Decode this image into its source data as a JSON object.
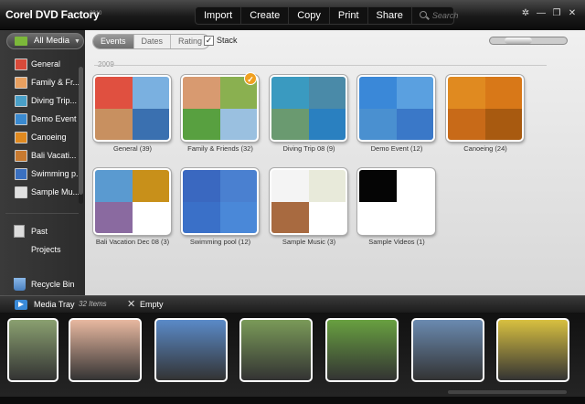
{
  "app": {
    "title": "Corel DVD Factory",
    "version": "2010"
  },
  "menu": [
    {
      "label": "Import"
    },
    {
      "label": "Create"
    },
    {
      "label": "Copy"
    },
    {
      "label": "Print"
    },
    {
      "label": "Share"
    }
  ],
  "search": {
    "placeholder": "Search"
  },
  "window_controls": {
    "settings": "✲",
    "minimize": "—",
    "restore": "❐",
    "close": "✕"
  },
  "sidebar": {
    "filter_label": "All Media",
    "items": [
      {
        "label": "General",
        "color": "#d84a3a"
      },
      {
        "label": "Family & Fr...",
        "color": "#e8a060"
      },
      {
        "label": "Diving Trip...",
        "color": "#4aa0c8"
      },
      {
        "label": "Demo Event",
        "color": "#3a8ad0"
      },
      {
        "label": "Canoeing",
        "color": "#e08a20"
      },
      {
        "label": "Bali Vacati...",
        "color": "#c87a30"
      },
      {
        "label": "Swimming p...",
        "color": "#3a70c0"
      },
      {
        "label": "Sample Mu...",
        "color": "#e0e0e0"
      }
    ],
    "past_projects": "Past Projects",
    "recycle_bin": "Recycle Bin"
  },
  "toolbar": {
    "tabs": [
      {
        "label": "Events"
      },
      {
        "label": "Dates"
      },
      {
        "label": "Rating"
      }
    ],
    "stack_label": "Stack",
    "stack_checked": true,
    "stack_mark": "✓",
    "zoom_level": 0.3
  },
  "year": "2009",
  "albums": [
    {
      "label": "General (39)",
      "colors": [
        "#e05040",
        "#7ab0e0",
        "#c89060",
        "#3a70b0"
      ]
    },
    {
      "label": "Family & Friends (32)",
      "colors": [
        "#d89a70",
        "#8ab050",
        "#58a040",
        "#9ac0e0"
      ],
      "checked": true
    },
    {
      "label": "Diving Trip 08 (9)",
      "colors": [
        "#3a9ac0",
        "#4a8aa8",
        "#6a9a70",
        "#2a80c0"
      ]
    },
    {
      "label": "Demo Event (12)",
      "colors": [
        "#3a88d8",
        "#5aa0e0",
        "#4a90d0",
        "#3a78c8"
      ]
    },
    {
      "label": "Canoeing (24)",
      "colors": [
        "#e08a20",
        "#d87818",
        "#c86a18",
        "#a85a10"
      ]
    },
    {
      "label": "Bali Vacation Dec 08 (3)",
      "colors": [
        "#5a9ad0",
        "#c8901a",
        "#8a6aa0",
        "#ffffff"
      ]
    },
    {
      "label": "Swimming pool (12)",
      "colors": [
        "#3a68c0",
        "#4a80d0",
        "#3a70c8",
        "#4a88d8"
      ]
    },
    {
      "label": "Sample Music (3)",
      "colors": [
        "#f4f4f4",
        "#e8eada",
        "#a86a40",
        "#ffffff"
      ]
    },
    {
      "label": "Sample Videos (1)",
      "colors": [
        "#050505",
        "#ffffff",
        "#ffffff",
        "#ffffff"
      ]
    }
  ],
  "tray": {
    "title": "Media Tray",
    "count": "32 Items",
    "empty_label": "Empty",
    "empty_icon": "✕",
    "thumbs": [
      {
        "color": "#8aa070"
      },
      {
        "color": "#e8b8a0"
      },
      {
        "color": "#5a8ac8"
      },
      {
        "color": "#7a9a58"
      },
      {
        "color": "#68a040"
      },
      {
        "color": "#6a8ab0"
      },
      {
        "color": "#d8c040"
      }
    ]
  }
}
